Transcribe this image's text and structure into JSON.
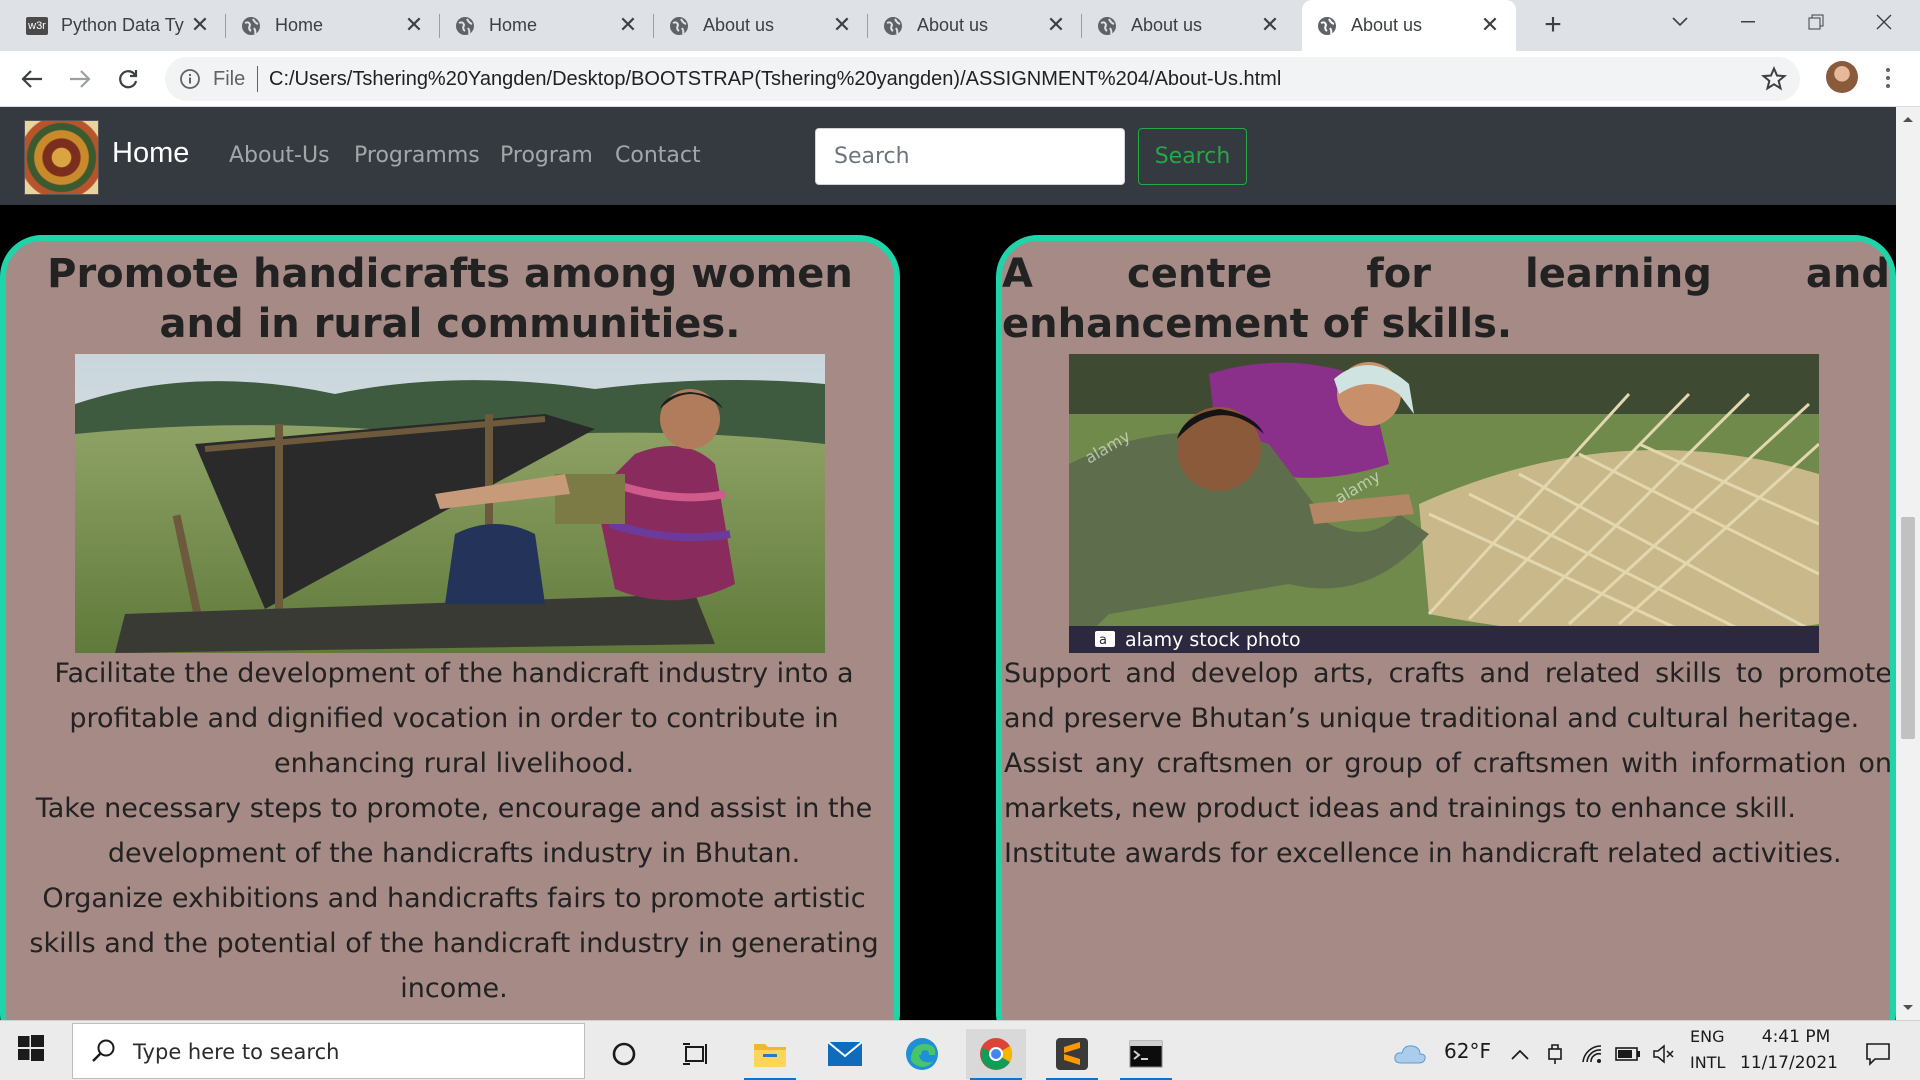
{
  "browser": {
    "tabs": [
      {
        "title": "Python Data Ty",
        "favicon": "w3-favicon",
        "favicon_text": "w3r",
        "active": false
      },
      {
        "title": "Home",
        "favicon": "globe-icon",
        "active": false
      },
      {
        "title": "Home",
        "favicon": "globe-icon",
        "active": false
      },
      {
        "title": "About us",
        "favicon": "globe-icon",
        "active": false
      },
      {
        "title": "About us",
        "favicon": "globe-icon",
        "active": false
      },
      {
        "title": "About us",
        "favicon": "globe-icon",
        "active": false
      },
      {
        "title": "About us",
        "favicon": "globe-icon",
        "active": true
      }
    ],
    "address": {
      "scheme_label": "File",
      "url": "C:/Users/Tshering%20Yangden/Desktop/BOOTSTRAP(Tshering%20yangden)/ASSIGNMENT%204/About-Us.html"
    }
  },
  "page": {
    "navbar": {
      "brand": "Home",
      "links": [
        "About-Us",
        "Programms",
        "Program",
        "Contact"
      ],
      "search_placeholder": "Search",
      "search_button": "Search"
    },
    "cards": [
      {
        "heading": "Promote handicrafts among women and in rural communities.",
        "image": "Woman weaving on a traditional loom in a mountain valley",
        "paragraphs": [
          "Facilitate the development of the handicraft industry into a profitable and dignified vocation in order to contribute in enhancing rural livelihood.",
          "Take necessary steps to promote, encourage and assist in the development of the handicrafts industry in Bhutan.",
          "Organize exhibitions and handicrafts fairs to promote artistic skills and the potential of the handicraft industry in generating income."
        ]
      },
      {
        "heading": "A centre for learning and enhancement of skills.",
        "image": "Craftsman weaving a bamboo basket",
        "image_caption": "alamy stock photo",
        "watermark": "alamy",
        "paragraphs": [
          "Support and develop arts, crafts and related skills to promote and preserve Bhutan’s unique traditional and cultural heritage.",
          "Assist any craftsmen or group of craftsmen with information on markets, new product ideas and trainings to enhance skill.",
          "Institute awards for excellence in handicraft related activities."
        ]
      }
    ],
    "colors": {
      "card_bg": "#a68a86",
      "card_border": "#1fd4a8",
      "navbar_bg": "#343a40",
      "search_btn": "#28a745"
    }
  },
  "taskbar": {
    "search_placeholder": "Type here to search",
    "weather": "62°F",
    "language": "ENG",
    "layout": "INTL",
    "time": "4:41 PM",
    "date": "11/17/2021",
    "apps": [
      "cortana-icon",
      "task-view-icon",
      "file-explorer-icon",
      "mail-icon",
      "edge-icon",
      "chrome-icon",
      "sublime-text-icon",
      "terminal-icon"
    ]
  }
}
